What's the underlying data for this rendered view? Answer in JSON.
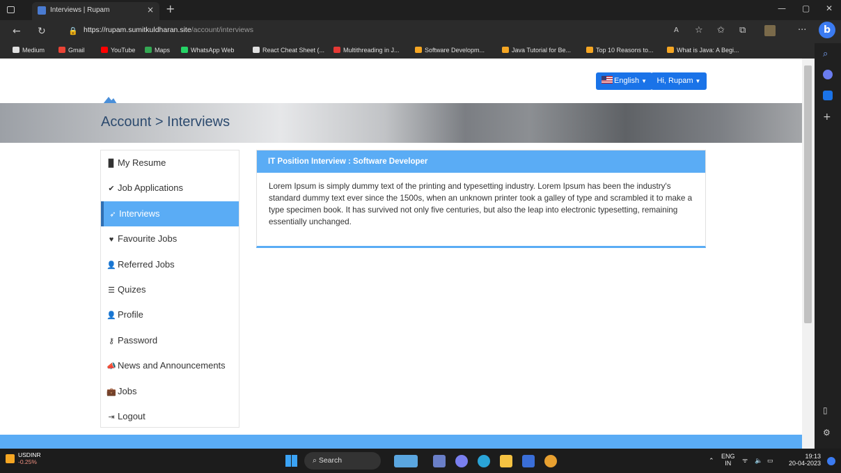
{
  "browser": {
    "tab_title": "Interviews | Rupam",
    "tab_close": "×",
    "new_tab": "+",
    "url_main": "https://rupam.sumitkuldharan.site",
    "url_path": "/account/interviews",
    "bookmarks": [
      {
        "label": "Medium",
        "icon": "medium-icon",
        "color": "#e0e0e0"
      },
      {
        "label": "Gmail",
        "icon": "gmail-icon",
        "color": "#ea4335"
      },
      {
        "label": "YouTube",
        "icon": "youtube-icon",
        "color": "#ff0000"
      },
      {
        "label": "Maps",
        "icon": "maps-icon",
        "color": "#34a853"
      },
      {
        "label": "WhatsApp Web",
        "icon": "whatsapp-icon",
        "color": "#25d366"
      },
      {
        "label": "React Cheat Sheet (...",
        "icon": "react-icon",
        "color": "#e0e0e0"
      },
      {
        "label": "Multithreading in J...",
        "icon": "bookmark-red-icon",
        "color": "#e53935"
      },
      {
        "label": "Software Developm...",
        "icon": "bookmark-icon",
        "color": "#f5a623"
      },
      {
        "label": "Java Tutorial for Be...",
        "icon": "bookmark-icon",
        "color": "#f5a623"
      },
      {
        "label": "Top 10 Reasons to...",
        "icon": "bookmark-icon",
        "color": "#f5a623"
      },
      {
        "label": "What is Java: A Begi...",
        "icon": "bookmark-icon",
        "color": "#f5a623"
      }
    ]
  },
  "header": {
    "language_label": "English",
    "user_label": "Hi, Rupam"
  },
  "banner": {
    "title": "Account > Interviews"
  },
  "sidebar": {
    "items": [
      {
        "label": "My Resume",
        "icon": "file-icon",
        "glyph": "▉"
      },
      {
        "label": "Job Applications",
        "icon": "check-icon",
        "glyph": "✔"
      },
      {
        "label": "Interviews",
        "icon": "thumbtack-icon",
        "glyph": "➶",
        "active": true
      },
      {
        "label": "Favourite Jobs",
        "icon": "heart-icon",
        "glyph": "♥"
      },
      {
        "label": "Referred Jobs",
        "icon": "user-plus-icon",
        "glyph": "👤"
      },
      {
        "label": "Quizes",
        "icon": "list-icon",
        "glyph": "☰"
      },
      {
        "label": "Profile",
        "icon": "user-icon",
        "glyph": "👤"
      },
      {
        "label": "Password",
        "icon": "key-icon",
        "glyph": "⚷"
      },
      {
        "label": "News and Announcements",
        "icon": "bullhorn-icon",
        "glyph": "📣"
      },
      {
        "label": "Jobs",
        "icon": "briefcase-icon",
        "glyph": "💼"
      },
      {
        "label": "Logout",
        "icon": "sign-out-icon",
        "glyph": "⇥"
      }
    ]
  },
  "panel": {
    "title": "IT Position Interview : Software Developer",
    "body": "Lorem Ipsum is simply dummy text of the printing and typesetting industry. Lorem Ipsum has been the industry's standard dummy text ever since the 1500s, when an unknown printer took a galley of type and scrambled it to make a type specimen book. It has survived not only five centuries, but also the leap into electronic typesetting, remaining essentially unchanged."
  },
  "taskbar": {
    "stock_name": "USDINR",
    "stock_change": "-0.25%",
    "search_label": "Search",
    "lang_top": "ENG",
    "lang_bottom": "IN",
    "time": "19:13",
    "date": "20-04-2023"
  },
  "colors": {
    "accent": "#5aacf5",
    "button": "#1a73e8",
    "title_text": "#2c4a6e"
  }
}
